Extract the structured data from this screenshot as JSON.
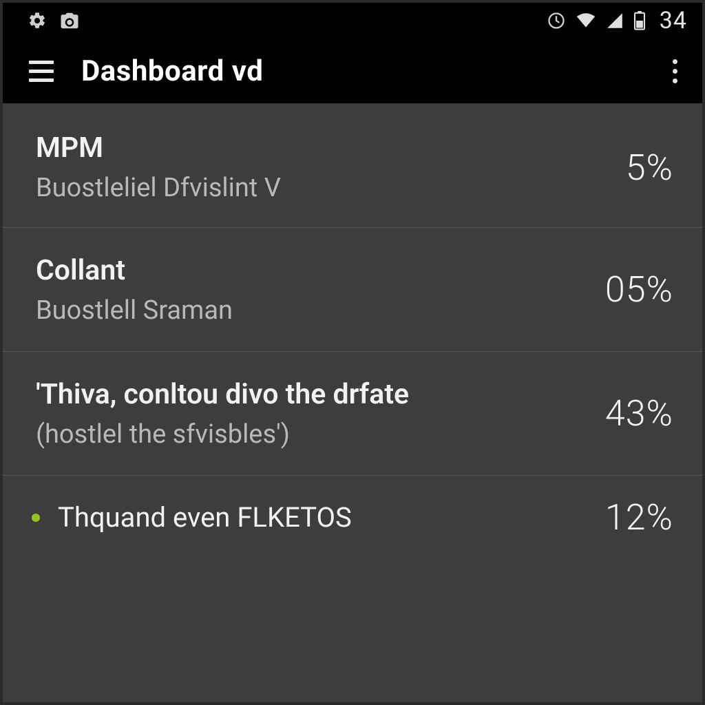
{
  "statusbar": {
    "battery_text": "34"
  },
  "appbar": {
    "title": "Dashboard vd"
  },
  "rows": [
    {
      "title": "MPM",
      "subtitle": "Buostleliel Dfvislint V",
      "value": "5%"
    },
    {
      "title": "Collant",
      "subtitle": "Buostlell Sraman",
      "value": "05%"
    },
    {
      "title": "'Thiva, conltou divo the drfate",
      "subtitle": "(hostlel the sfvisbles')",
      "value": "43%"
    },
    {
      "title": "Thquand even FLKETOS",
      "value": "12%"
    }
  ]
}
